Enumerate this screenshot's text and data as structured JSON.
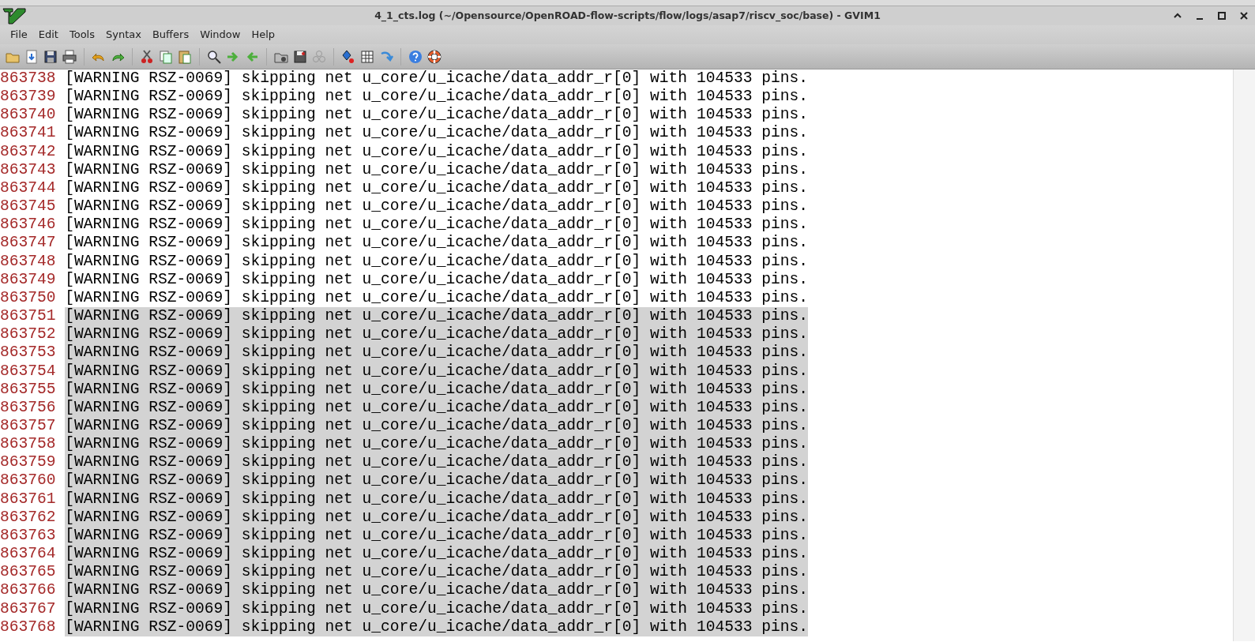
{
  "window": {
    "title": "4_1_cts.log (~/Opensource/OpenROAD-flow-scripts/flow/logs/asap7/riscv_soc/base) - GVIM1"
  },
  "menu": [
    "File",
    "Edit",
    "Tools",
    "Syntax",
    "Buffers",
    "Window",
    "Help"
  ],
  "lines": [
    {
      "number": "863738",
      "text": "[WARNING RSZ-0069] skipping net u_core/u_icache/data_addr_r[0] with 104533 pins.",
      "selected": false
    },
    {
      "number": "863739",
      "text": "[WARNING RSZ-0069] skipping net u_core/u_icache/data_addr_r[0] with 104533 pins.",
      "selected": false
    },
    {
      "number": "863740",
      "text": "[WARNING RSZ-0069] skipping net u_core/u_icache/data_addr_r[0] with 104533 pins.",
      "selected": false
    },
    {
      "number": "863741",
      "text": "[WARNING RSZ-0069] skipping net u_core/u_icache/data_addr_r[0] with 104533 pins.",
      "selected": false
    },
    {
      "number": "863742",
      "text": "[WARNING RSZ-0069] skipping net u_core/u_icache/data_addr_r[0] with 104533 pins.",
      "selected": false
    },
    {
      "number": "863743",
      "text": "[WARNING RSZ-0069] skipping net u_core/u_icache/data_addr_r[0] with 104533 pins.",
      "selected": false
    },
    {
      "number": "863744",
      "text": "[WARNING RSZ-0069] skipping net u_core/u_icache/data_addr_r[0] with 104533 pins.",
      "selected": false
    },
    {
      "number": "863745",
      "text": "[WARNING RSZ-0069] skipping net u_core/u_icache/data_addr_r[0] with 104533 pins.",
      "selected": false
    },
    {
      "number": "863746",
      "text": "[WARNING RSZ-0069] skipping net u_core/u_icache/data_addr_r[0] with 104533 pins.",
      "selected": false
    },
    {
      "number": "863747",
      "text": "[WARNING RSZ-0069] skipping net u_core/u_icache/data_addr_r[0] with 104533 pins.",
      "selected": false
    },
    {
      "number": "863748",
      "text": "[WARNING RSZ-0069] skipping net u_core/u_icache/data_addr_r[0] with 104533 pins.",
      "selected": false
    },
    {
      "number": "863749",
      "text": "[WARNING RSZ-0069] skipping net u_core/u_icache/data_addr_r[0] with 104533 pins.",
      "selected": false
    },
    {
      "number": "863750",
      "text": "[WARNING RSZ-0069] skipping net u_core/u_icache/data_addr_r[0] with 104533 pins.",
      "selected": false
    },
    {
      "number": "863751",
      "text": "[WARNING RSZ-0069] skipping net u_core/u_icache/data_addr_r[0] with 104533 pins.",
      "selected": true
    },
    {
      "number": "863752",
      "text": "[WARNING RSZ-0069] skipping net u_core/u_icache/data_addr_r[0] with 104533 pins.",
      "selected": true
    },
    {
      "number": "863753",
      "text": "[WARNING RSZ-0069] skipping net u_core/u_icache/data_addr_r[0] with 104533 pins.",
      "selected": true
    },
    {
      "number": "863754",
      "text": "[WARNING RSZ-0069] skipping net u_core/u_icache/data_addr_r[0] with 104533 pins.",
      "selected": true
    },
    {
      "number": "863755",
      "text": "[WARNING RSZ-0069] skipping net u_core/u_icache/data_addr_r[0] with 104533 pins.",
      "selected": true
    },
    {
      "number": "863756",
      "text": "[WARNING RSZ-0069] skipping net u_core/u_icache/data_addr_r[0] with 104533 pins.",
      "selected": true
    },
    {
      "number": "863757",
      "text": "[WARNING RSZ-0069] skipping net u_core/u_icache/data_addr_r[0] with 104533 pins.",
      "selected": true
    },
    {
      "number": "863758",
      "text": "[WARNING RSZ-0069] skipping net u_core/u_icache/data_addr_r[0] with 104533 pins.",
      "selected": true
    },
    {
      "number": "863759",
      "text": "[WARNING RSZ-0069] skipping net u_core/u_icache/data_addr_r[0] with 104533 pins.",
      "selected": true
    },
    {
      "number": "863760",
      "text": "[WARNING RSZ-0069] skipping net u_core/u_icache/data_addr_r[0] with 104533 pins.",
      "selected": true
    },
    {
      "number": "863761",
      "text": "[WARNING RSZ-0069] skipping net u_core/u_icache/data_addr_r[0] with 104533 pins.",
      "selected": true
    },
    {
      "number": "863762",
      "text": "[WARNING RSZ-0069] skipping net u_core/u_icache/data_addr_r[0] with 104533 pins.",
      "selected": true
    },
    {
      "number": "863763",
      "text": "[WARNING RSZ-0069] skipping net u_core/u_icache/data_addr_r[0] with 104533 pins.",
      "selected": true
    },
    {
      "number": "863764",
      "text": "[WARNING RSZ-0069] skipping net u_core/u_icache/data_addr_r[0] with 104533 pins.",
      "selected": true
    },
    {
      "number": "863765",
      "text": "[WARNING RSZ-0069] skipping net u_core/u_icache/data_addr_r[0] with 104533 pins.",
      "selected": true
    },
    {
      "number": "863766",
      "text": "[WARNING RSZ-0069] skipping net u_core/u_icache/data_addr_r[0] with 104533 pins.",
      "selected": true
    },
    {
      "number": "863767",
      "text": "[WARNING RSZ-0069] skipping net u_core/u_icache/data_addr_r[0] with 104533 pins.",
      "selected": true
    },
    {
      "number": "863768",
      "text": "[WARNING RSZ-0069] skipping net u_core/u_icache/data_addr_r[0] with 104533 pins.",
      "selected": true
    }
  ]
}
